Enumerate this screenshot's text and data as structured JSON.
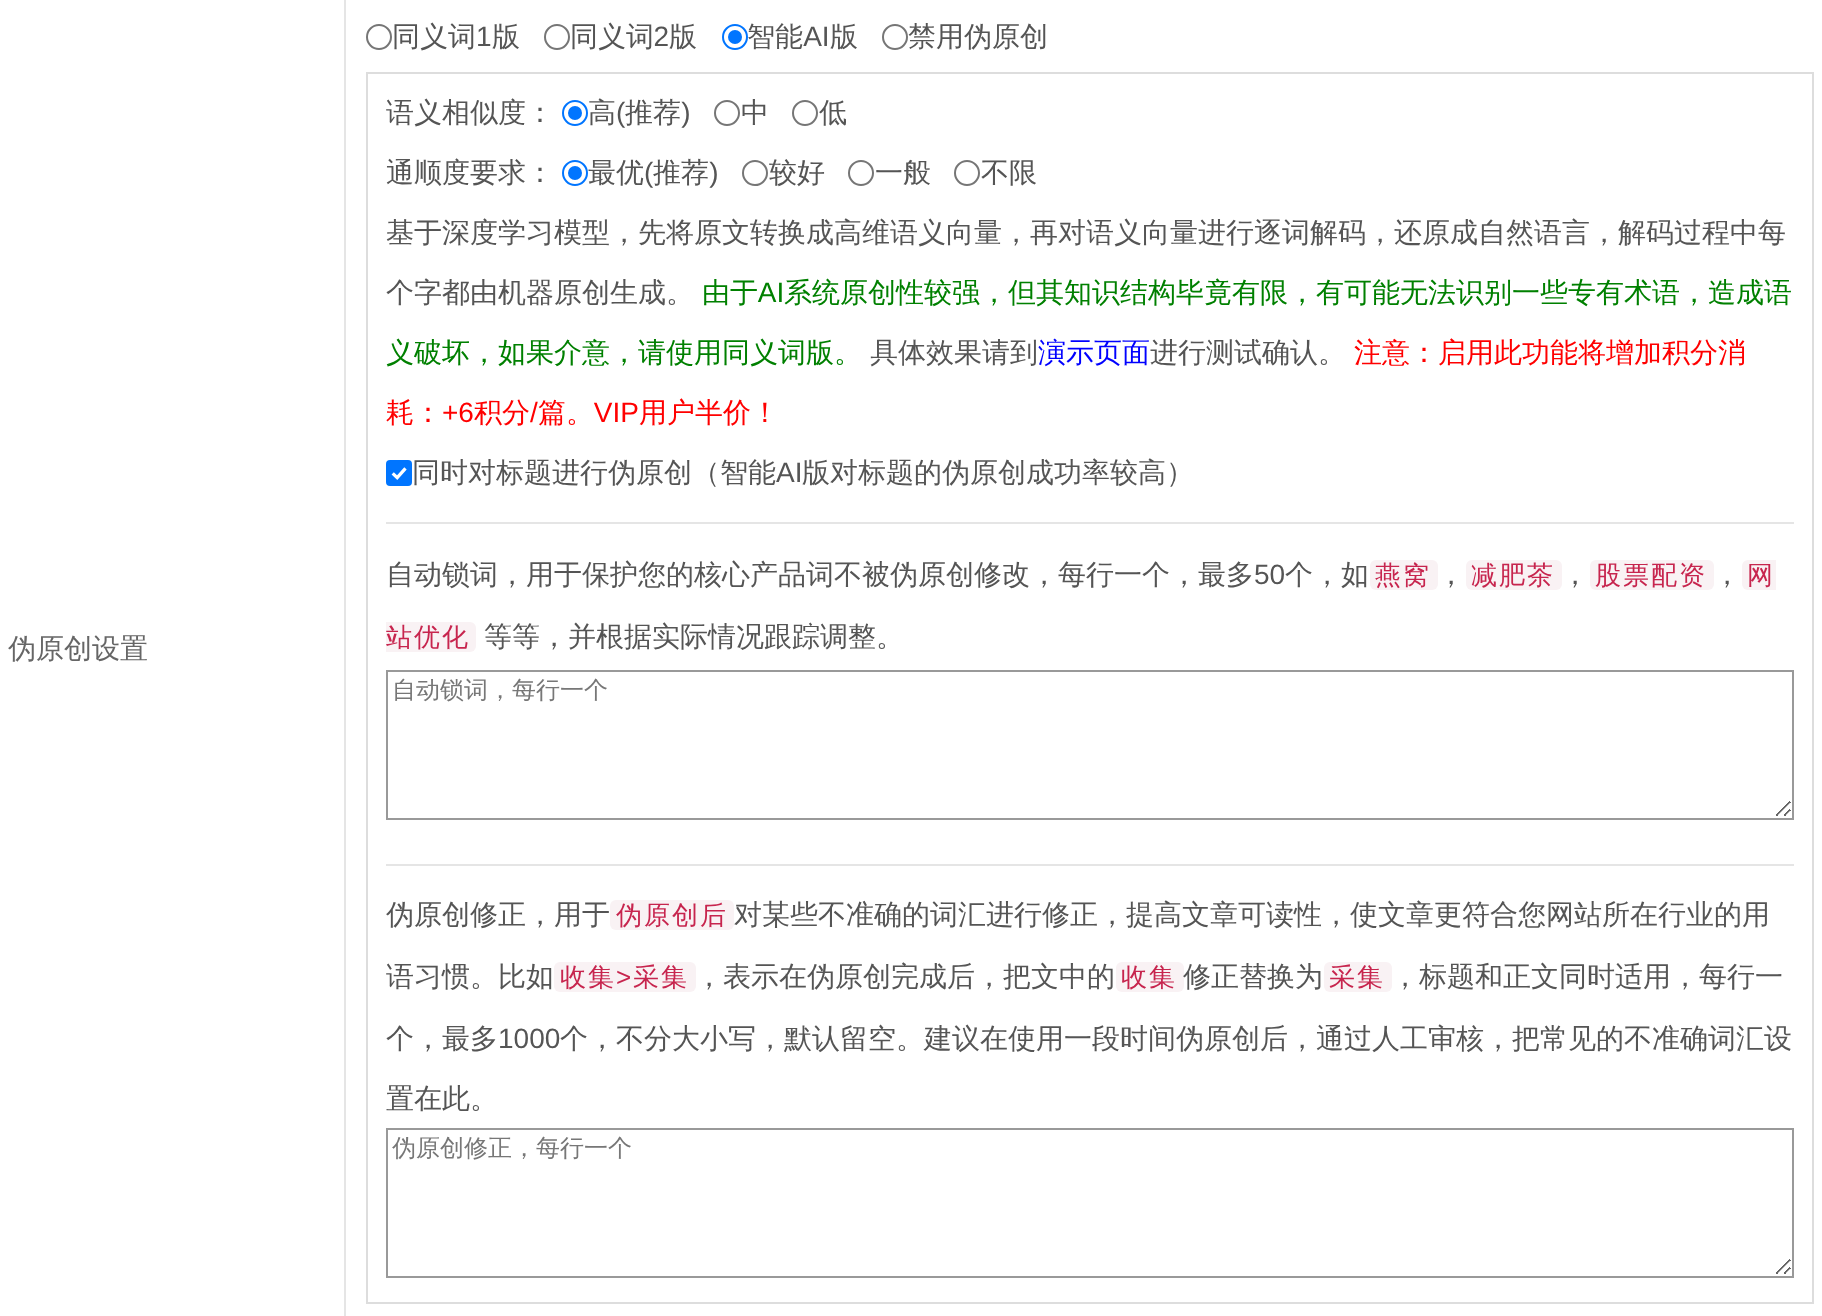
{
  "side_label": "伪原创设置",
  "mode_options": [
    {
      "label": "同义词1版",
      "selected": false
    },
    {
      "label": "同义词2版",
      "selected": false
    },
    {
      "label": "智能AI版",
      "selected": true
    },
    {
      "label": "禁用伪原创",
      "selected": false
    }
  ],
  "ai_settings": {
    "similarity": {
      "label": "语义相似度：",
      "options": [
        {
          "label": "高(推荐)",
          "selected": true
        },
        {
          "label": "中",
          "selected": false
        },
        {
          "label": "低",
          "selected": false
        }
      ]
    },
    "fluency": {
      "label": "通顺度要求：",
      "options": [
        {
          "label": "最优(推荐)",
          "selected": true
        },
        {
          "label": "较好",
          "selected": false
        },
        {
          "label": "一般",
          "selected": false
        },
        {
          "label": "不限",
          "selected": false
        }
      ]
    },
    "description": [
      {
        "kind": "text",
        "text": "基于深度学习模型，先将原文转换成高维语义向量，再对语义向量进行逐词解码，还原成自然语言，解码过程中每个字都由机器原创生成。 "
      },
      {
        "kind": "note",
        "text": "由于AI系统原创性较强，但其知识结构毕竟有限，有可能无法识别一些专有术语，造成语义破坏，如果介意，请使用同义词版。"
      },
      {
        "kind": "text",
        "text": " 具体效果请到"
      },
      {
        "kind": "link",
        "text": "演示页面"
      },
      {
        "kind": "text",
        "text": "进行测试确认。 "
      },
      {
        "kind": "warning",
        "text": "注意：启用此功能将增加积分消耗：+6积分/篇。VIP用户半价！"
      }
    ],
    "title_checkbox": {
      "label": "同时对标题进行伪原创（智能AI版对标题的伪原创成功率较高）",
      "checked": true
    }
  },
  "lock_words": {
    "description": [
      {
        "kind": "text",
        "text": "自动锁词，用于保护您的核心产品词不被伪原创修改，每行一个，最多50个，如"
      },
      {
        "kind": "code",
        "text": "燕窝"
      },
      {
        "kind": "text",
        "text": "，"
      },
      {
        "kind": "code",
        "text": "减肥茶"
      },
      {
        "kind": "text",
        "text": "，"
      },
      {
        "kind": "code",
        "text": "股票配资"
      },
      {
        "kind": "text",
        "text": "，"
      },
      {
        "kind": "code",
        "text": "网站优化"
      },
      {
        "kind": "text",
        "text": " 等等，并根据实际情况跟踪调整。"
      }
    ],
    "placeholder": "自动锁词，每行一个"
  },
  "corrections": {
    "description": [
      {
        "kind": "text",
        "text": "伪原创修正，用于"
      },
      {
        "kind": "code",
        "text": "伪原创后"
      },
      {
        "kind": "text",
        "text": "对某些不准确的词汇进行修正，提高文章可读性，使文章更符合您网站所在行业的用语习惯。比如"
      },
      {
        "kind": "code",
        "text": "收集>采集"
      },
      {
        "kind": "text",
        "text": "，表示在伪原创完成后，把文中的"
      },
      {
        "kind": "code",
        "text": "收集"
      },
      {
        "kind": "text",
        "text": "修正替换为"
      },
      {
        "kind": "code",
        "text": "采集"
      },
      {
        "kind": "text",
        "text": "，标题和正文同时适用，每行一个，最多1000个，不分大小写，默认留空。建议在使用一段时间伪原创后，通过人工审核，把常见的不准确词汇设置在此。"
      }
    ],
    "placeholder": "伪原创修正，每行一个"
  }
}
